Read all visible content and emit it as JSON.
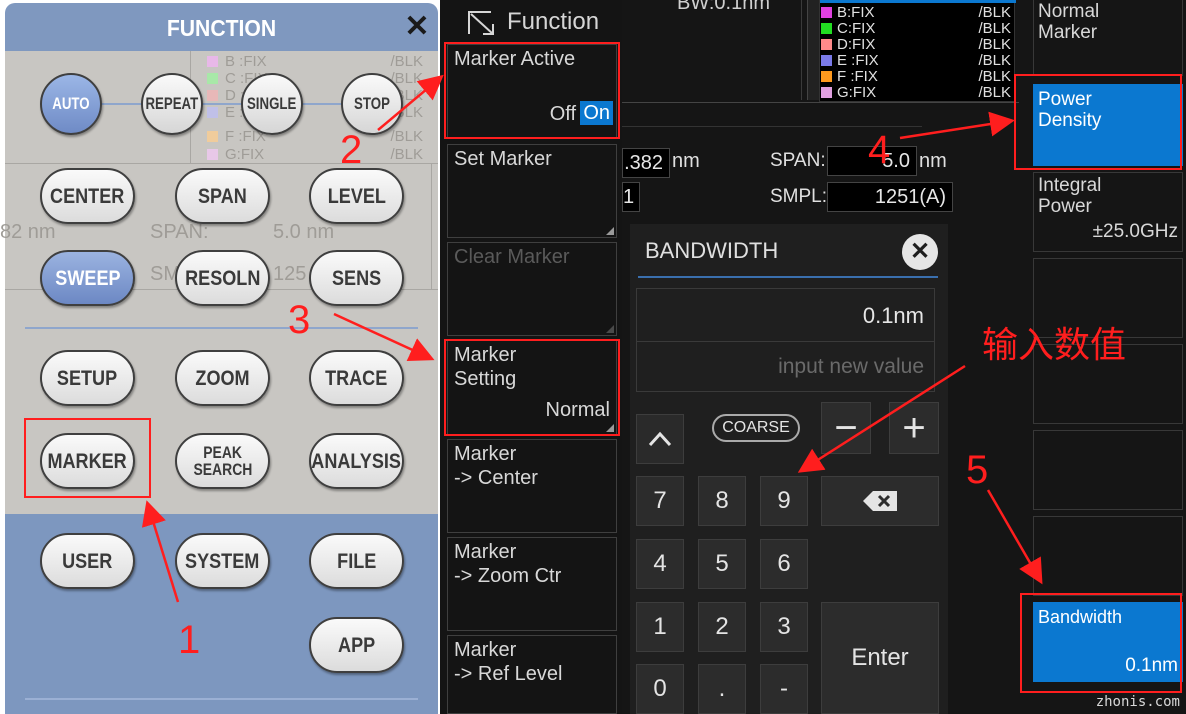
{
  "function_panel": {
    "title": "FUNCTION",
    "close_icon": "close-icon",
    "background_traces": [
      {
        "label": "B :FIX",
        "mode": "/BLK",
        "color": "#e8b8e8"
      },
      {
        "label": "C :FIX",
        "mode": "/BLK",
        "color": "#a8e8a8"
      },
      {
        "label": "D :FIX",
        "mode": "/BLK",
        "color": "#e8b8b8"
      },
      {
        "label": "E :FIX",
        "mode": "/BLK",
        "color": "#c0c0e8"
      },
      {
        "label": "F :FIX",
        "mode": "/BLK",
        "color": "#f0cc9c"
      },
      {
        "label": "G:FIX",
        "mode": "/BLK",
        "color": "#e8c8e8"
      }
    ],
    "ghost_center": "82 nm",
    "ghost_span_label": "SPAN:",
    "ghost_span_value": "5.0 nm",
    "ghost_smpl_label": "SM",
    "ghost_smpl_value": "125",
    "sweep_buttons": {
      "auto": "AUTO",
      "repeat": "REPEAT",
      "single": "SINGLE",
      "stop": "STOP"
    },
    "keys": {
      "center": "CENTER",
      "span": "SPAN",
      "level": "LEVEL",
      "sweep": "SWEEP",
      "resoln": "RESOLN",
      "sens": "SENS",
      "setup": "SETUP",
      "zoom": "ZOOM",
      "trace": "TRACE",
      "marker": "MARKER",
      "peak_search_1": "PEAK",
      "peak_search_2": "SEARCH",
      "analysis": "ANALYSIS",
      "user": "USER",
      "system": "SYSTEM",
      "file": "FILE",
      "app": "APP"
    }
  },
  "function_softkeys": {
    "title": "Function",
    "items": [
      {
        "line1": "Marker Active",
        "off": "Off",
        "on": "On"
      },
      {
        "line1": "Set Marker"
      },
      {
        "line1": "Clear Marker"
      },
      {
        "line1": "Marker",
        "line2": "Setting",
        "value": "Normal"
      },
      {
        "line1": "Marker",
        "line2": "-> Center"
      },
      {
        "line1": "Marker",
        "line2": "-> Zoom Ctr"
      },
      {
        "line1": "Marker",
        "line2": "-> Ref Level"
      }
    ]
  },
  "instrument": {
    "bw_top": "BW:0.1nm",
    "traces": [
      {
        "label": "B:FIX",
        "mode": "/BLK",
        "color": "#e040e0"
      },
      {
        "label": "C:FIX",
        "mode": "/BLK",
        "color": "#22dd22"
      },
      {
        "label": "D:FIX",
        "mode": "/BLK",
        "color": "#ff8a8a"
      },
      {
        "label": "E :FIX",
        "mode": "/BLK",
        "color": "#7a7ae8"
      },
      {
        "label": "F :FIX",
        "mode": "/BLK",
        "color": "#ff9a1e"
      },
      {
        "label": "G:FIX",
        "mode": "/BLK",
        "color": "#e0a0e0"
      }
    ],
    "center_value": ".382",
    "center_unit": "nm",
    "span_label": "SPAN:",
    "span_value": "5.0",
    "span_unit": "nm",
    "smpl_label": "SMPL:",
    "smpl_value": "1251(A)",
    "left_field": "1"
  },
  "bandwidth_dialog": {
    "title": "BANDWIDTH",
    "current_value": "0.1nm",
    "placeholder": "input new value",
    "coarse": "COARSE",
    "keys": [
      "7",
      "8",
      "9",
      "4",
      "5",
      "6",
      "1",
      "2",
      "3",
      "0",
      ".",
      "-"
    ],
    "enter": "Enter",
    "minus": "−",
    "plus": "+"
  },
  "right_softkeys": {
    "items": [
      {
        "line1": "Normal",
        "line2": "Marker"
      },
      {
        "line1": "Power",
        "line2": "Density"
      },
      {
        "line1": "Integral",
        "line2": "Power",
        "value": "±25.0GHz"
      },
      {
        "line1": "Bandwidth",
        "value": "0.1nm"
      }
    ]
  },
  "annotations": {
    "steps": [
      "1",
      "2",
      "3",
      "4",
      "5"
    ],
    "input_label": "输入数值",
    "accent": "#ff1e1e"
  },
  "watermark": "zhonis.com"
}
